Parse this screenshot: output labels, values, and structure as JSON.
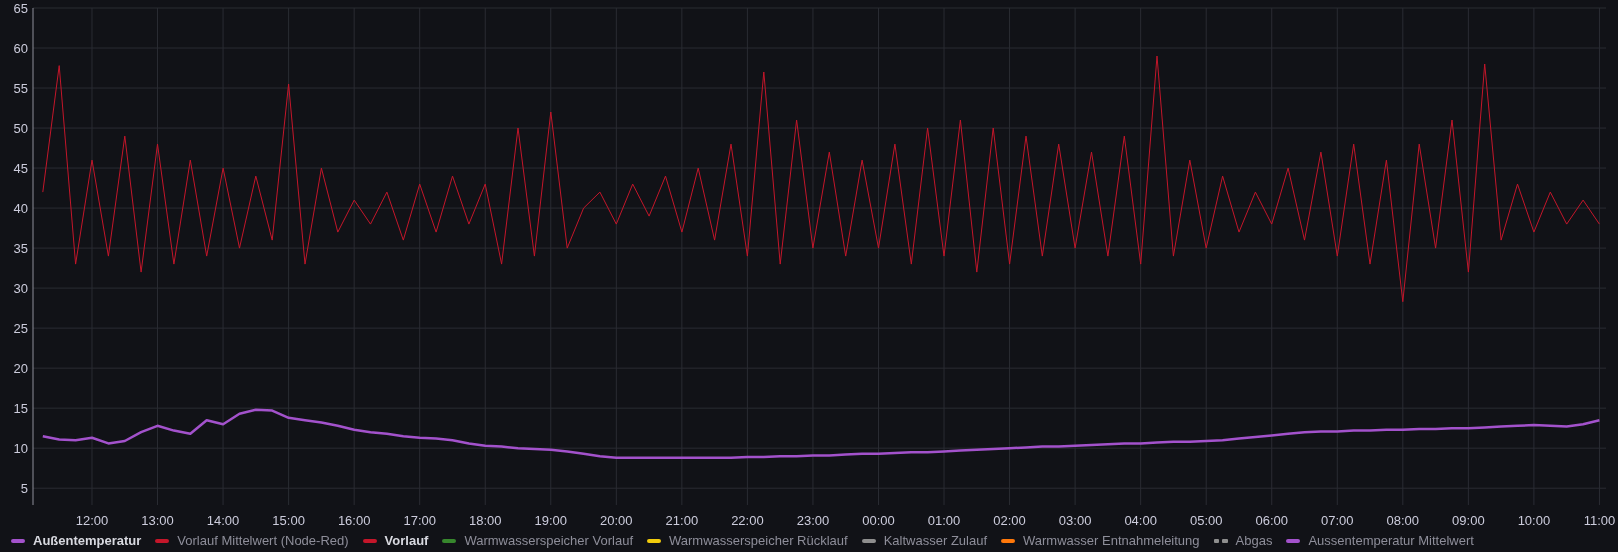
{
  "chart_data": {
    "type": "line",
    "grid": true,
    "ylim": [
      2.9,
      65
    ],
    "yticks": [
      5,
      10,
      15,
      20,
      25,
      30,
      35,
      40,
      45,
      50,
      55,
      60,
      65
    ],
    "categories": [
      null,
      null,
      null,
      "12:00",
      null,
      null,
      null,
      "13:00",
      null,
      null,
      null,
      "14:00",
      null,
      null,
      null,
      "15:00",
      null,
      null,
      null,
      "16:00",
      null,
      null,
      null,
      "17:00",
      null,
      null,
      null,
      "18:00",
      null,
      null,
      null,
      "19:00",
      null,
      null,
      null,
      "20:00",
      null,
      null,
      null,
      "21:00",
      null,
      null,
      null,
      "22:00",
      null,
      null,
      null,
      "23:00",
      null,
      null,
      null,
      "00:00",
      null,
      null,
      null,
      "01:00",
      null,
      null,
      null,
      "02:00",
      null,
      null,
      null,
      "03:00",
      null,
      null,
      null,
      "04:00",
      null,
      null,
      null,
      "05:00",
      null,
      null,
      null,
      "06:00",
      null,
      null,
      null,
      "07:00",
      null,
      null,
      null,
      "08:00",
      null,
      null,
      null,
      "09:00",
      null,
      null,
      null,
      "10:00",
      null,
      null,
      null,
      "11:00"
    ],
    "series": [
      {
        "name": "Außentemperatur",
        "color": "#a352cc",
        "values": [
          11.5,
          11.1,
          11,
          11.3,
          10.6,
          10.9,
          12,
          12.8,
          12.2,
          11.8,
          13.5,
          13,
          14.3,
          14.8,
          14.7,
          13.8,
          13.5,
          13.2,
          12.8,
          12.3,
          12,
          11.8,
          11.5,
          11.3,
          11.2,
          11,
          10.6,
          10.3,
          10.2,
          10,
          9.9,
          9.8,
          9.6,
          9.3,
          9,
          8.8,
          8.8,
          8.8,
          8.8,
          8.8,
          8.8,
          8.8,
          8.8,
          8.9,
          8.9,
          9,
          9,
          9.1,
          9.1,
          9.2,
          9.3,
          9.3,
          9.4,
          9.5,
          9.5,
          9.6,
          9.7,
          9.8,
          9.9,
          10,
          10.1,
          10.2,
          10.2,
          10.3,
          10.4,
          10.5,
          10.6,
          10.6,
          10.7,
          10.8,
          10.8,
          10.9,
          11,
          11.2,
          11.4,
          11.6,
          11.8,
          12,
          12.1,
          12.1,
          12.2,
          12.2,
          12.3,
          12.3,
          12.4,
          12.4,
          12.5,
          12.5,
          12.6,
          12.7,
          12.8,
          12.9,
          12.8,
          12.7,
          13,
          13.5
        ]
      },
      {
        "name": "Vorlauf",
        "color": "#c4162a",
        "values": [
          42,
          57.8,
          33,
          46,
          34,
          49,
          32,
          48,
          33,
          46,
          34,
          45,
          35,
          44,
          36,
          55.5,
          33,
          45,
          37,
          41,
          38,
          42,
          36,
          43,
          37,
          44,
          38,
          43,
          33,
          50,
          34,
          52,
          35,
          40,
          42,
          38,
          43,
          39,
          44,
          37,
          45,
          36,
          48,
          34,
          57,
          33,
          51,
          35,
          47,
          34,
          46,
          35,
          48,
          33,
          50,
          34,
          51,
          32,
          50,
          33,
          49,
          34,
          48,
          35,
          47,
          34,
          49,
          33,
          59,
          34,
          46,
          35,
          44,
          37,
          42,
          38,
          45,
          36,
          47,
          34,
          48,
          33,
          46,
          28.3,
          48,
          35,
          51,
          32,
          58,
          36,
          43,
          37,
          42,
          38,
          41,
          38
        ]
      }
    ]
  },
  "legend": [
    {
      "kind": "solid",
      "visible": true
    },
    {
      "label": "Vorlauf Mittelwert (Node-Red)",
      "color": "#c4162a",
      "kind": "solid",
      "visible": false
    },
    {
      "kind": "solid",
      "visible": true
    },
    {
      "label": "Warmwasserspeicher Vorlauf",
      "color": "#37872d",
      "kind": "solid",
      "visible": false
    },
    {
      "label": "Warmwasserspeicher Rücklauf",
      "color": "#f2cc0c",
      "kind": "solid",
      "visible": false
    },
    {
      "label": "Kaltwasser Zulauf",
      "color": "#8e8e8e",
      "kind": "solid",
      "visible": false
    },
    {
      "label": "Warmwasser Entnahmeleitung",
      "color": "#ff780a",
      "kind": "solid",
      "visible": false
    },
    {
      "label": "Abgas",
      "color": "#8e8e8e",
      "kind": "dashed",
      "visible": false
    },
    {
      "label": "Aussentemperatur Mittelwert",
      "color": "#a352cc",
      "kind": "solid",
      "visible": false
    }
  ]
}
